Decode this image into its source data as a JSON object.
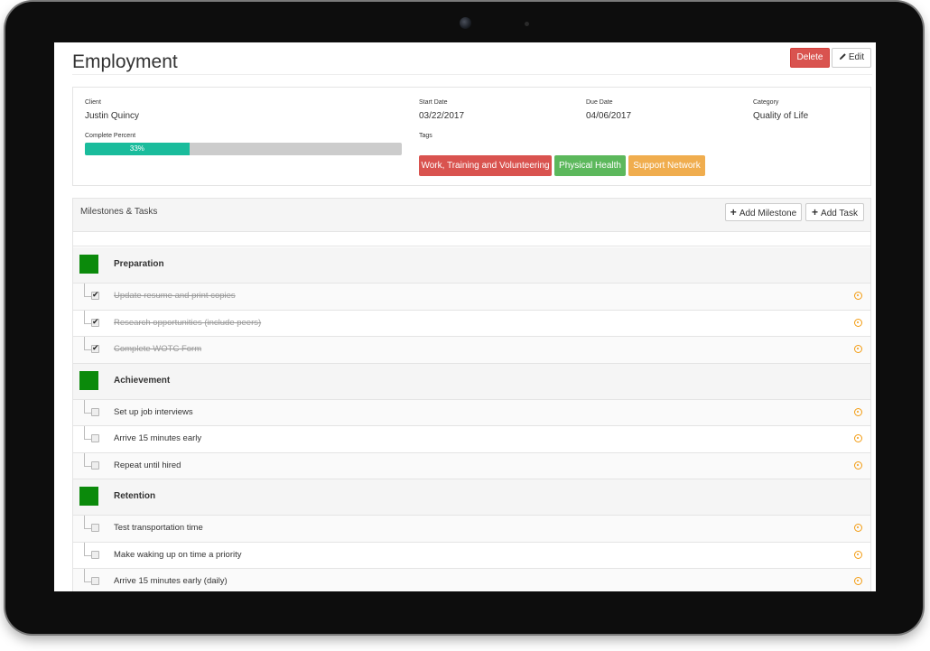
{
  "page": {
    "title": "Employment"
  },
  "actions": {
    "delete_label": "Delete",
    "edit_label": "Edit"
  },
  "info": {
    "client_label": "Client",
    "client": "Justin Quincy",
    "start_label": "Start Date",
    "start": "03/22/2017",
    "due_label": "Due Date",
    "due": "04/06/2017",
    "category_label": "Category",
    "category": "Quality of Life",
    "complete_label": "Complete Percent",
    "complete": "33%",
    "complete_fraction": 0.33,
    "tags_label": "Tags",
    "tags": [
      {
        "label": "Work, Training and Volunteering",
        "color": "#d9534f"
      },
      {
        "label": "Physical Health",
        "color": "#5cb85c"
      },
      {
        "label": "Support Network",
        "color": "#f0ad4e"
      }
    ]
  },
  "milestones_panel": {
    "title": "Milestones & Tasks",
    "add_milestone_label": "Add Milestone",
    "add_task_label": "Add Task",
    "milestones": [
      {
        "title": "Preparation",
        "tasks": [
          {
            "title": "Update resume and print copies",
            "done": true
          },
          {
            "title": "Research opportunities (include peers)",
            "done": true
          },
          {
            "title": "Complete WOTC Form",
            "done": true
          }
        ]
      },
      {
        "title": "Achievement",
        "tasks": [
          {
            "title": "Set up job interviews",
            "done": false
          },
          {
            "title": "Arrive 15 minutes early",
            "done": false
          },
          {
            "title": "Repeat until hired",
            "done": false
          }
        ]
      },
      {
        "title": "Retention",
        "tasks": [
          {
            "title": "Test transportation time",
            "done": false
          },
          {
            "title": "Make waking up on time a priority",
            "done": false
          },
          {
            "title": "Arrive 15 minutes early (daily)",
            "done": false
          }
        ]
      }
    ]
  }
}
